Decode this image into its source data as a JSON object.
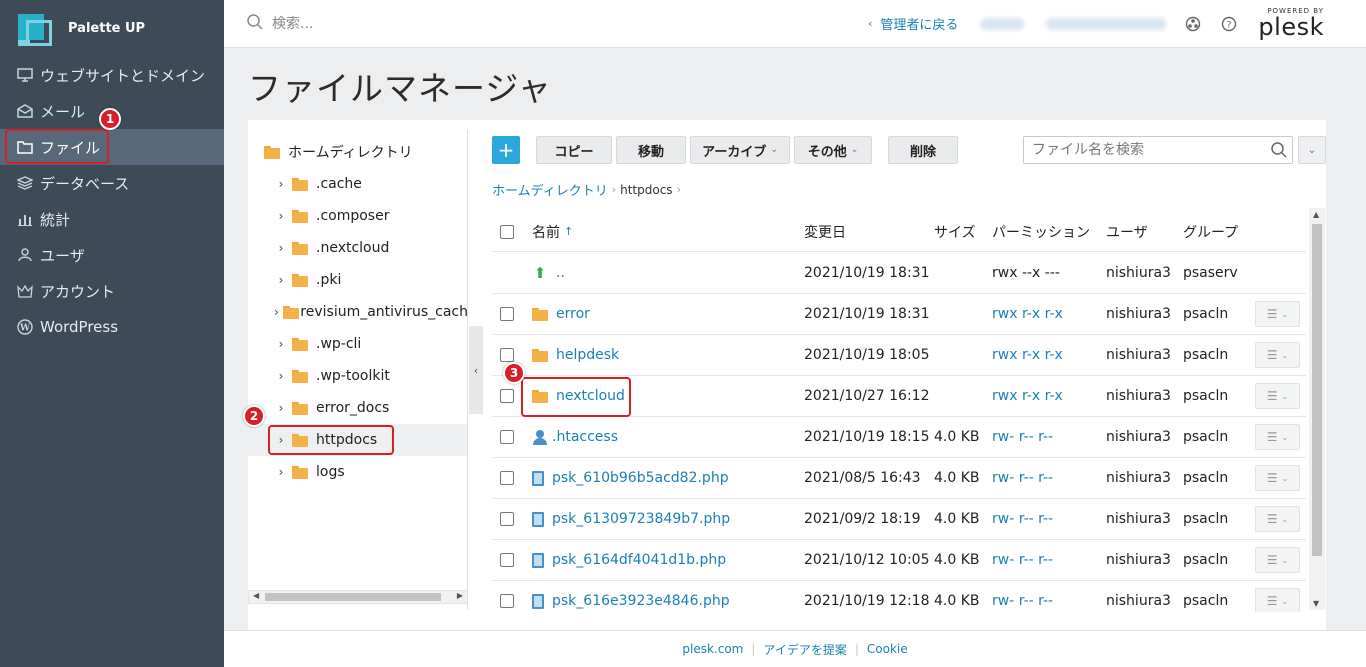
{
  "brand": {
    "name": "Palette UP"
  },
  "sidebar": {
    "items": [
      {
        "label": "ウェブサイトとドメイン",
        "icon": "monitor-icon"
      },
      {
        "label": "メール",
        "icon": "mail-icon"
      },
      {
        "label": "ファイル",
        "icon": "folder-icon",
        "active": true
      },
      {
        "label": "データベース",
        "icon": "database-icon"
      },
      {
        "label": "統計",
        "icon": "stats-icon"
      },
      {
        "label": "ユーザ",
        "icon": "user-icon"
      },
      {
        "label": "アカウント",
        "icon": "account-icon"
      },
      {
        "label": "WordPress",
        "icon": "wordpress-icon"
      }
    ]
  },
  "header": {
    "search_placeholder": "検索...",
    "back_link": "管理者に戻る",
    "logo_powered": "POWERED BY",
    "logo_name": "plesk"
  },
  "page": {
    "title": "ファイルマネージャ"
  },
  "tree": {
    "root": "ホームディレクトリ",
    "items": [
      ".cache",
      ".composer",
      ".nextcloud",
      ".pki",
      ".revisium_antivirus_cach",
      ".wp-cli",
      ".wp-toolkit",
      "error_docs",
      "httpdocs",
      "logs"
    ],
    "selected": "httpdocs"
  },
  "toolbar": {
    "add_label": "+",
    "copy": "コピー",
    "move": "移動",
    "archive": "アーカイブ",
    "other": "その他",
    "delete": "削除",
    "search_placeholder": "ファイル名を検索"
  },
  "breadcrumb": {
    "home": "ホームディレクトリ",
    "current": "httpdocs"
  },
  "table": {
    "headers": {
      "name": "名前",
      "modified": "変更日",
      "size": "サイズ",
      "permission": "パーミッション",
      "user": "ユーザ",
      "group": "グループ"
    },
    "rows": [
      {
        "name": "..",
        "type": "up",
        "modified": "2021/10/19 18:31",
        "size": "",
        "perm": "rwx --x ---",
        "user": "nishiura3",
        "group": "psaserv"
      },
      {
        "name": "error",
        "type": "folder",
        "modified": "2021/10/19 18:31",
        "size": "",
        "perm": "rwx r-x r-x",
        "user": "nishiura3",
        "group": "psacln"
      },
      {
        "name": "helpdesk",
        "type": "folder",
        "modified": "2021/10/19 18:05",
        "size": "",
        "perm": "rwx r-x r-x",
        "user": "nishiura3",
        "group": "psacln"
      },
      {
        "name": "nextcloud",
        "type": "folder",
        "modified": "2021/10/27 16:12",
        "size": "",
        "perm": "rwx r-x r-x",
        "user": "nishiura3",
        "group": "psacln"
      },
      {
        "name": ".htaccess",
        "type": "user",
        "modified": "2021/10/19 18:15",
        "size": "4.0 KB",
        "perm": "rw- r-- r--",
        "user": "nishiura3",
        "group": "psacln"
      },
      {
        "name": "psk_610b96b5acd82.php",
        "type": "file",
        "modified": "2021/08/5 16:43",
        "size": "4.0 KB",
        "perm": "rw- r-- r--",
        "user": "nishiura3",
        "group": "psacln"
      },
      {
        "name": "psk_61309723849b7.php",
        "type": "file",
        "modified": "2021/09/2 18:19",
        "size": "4.0 KB",
        "perm": "rw- r-- r--",
        "user": "nishiura3",
        "group": "psacln"
      },
      {
        "name": "psk_6164df4041d1b.php",
        "type": "file",
        "modified": "2021/10/12 10:05",
        "size": "4.0 KB",
        "perm": "rw- r-- r--",
        "user": "nishiura3",
        "group": "psacln"
      },
      {
        "name": "psk_616e3923e4846.php",
        "type": "file",
        "modified": "2021/10/19 12:18",
        "size": "4.0 KB",
        "perm": "rw- r-- r--",
        "user": "nishiura3",
        "group": "psacln"
      }
    ]
  },
  "annotations": [
    "1",
    "2",
    "3"
  ],
  "footer": {
    "link1": "plesk.com",
    "link2": "アイデアを提案",
    "link3": "Cookie"
  },
  "colors": {
    "sidebar_bg": "#3d4a58",
    "accent": "#1c7fb6",
    "annotation": "#d4202b",
    "add_button": "#2ba7dc"
  }
}
